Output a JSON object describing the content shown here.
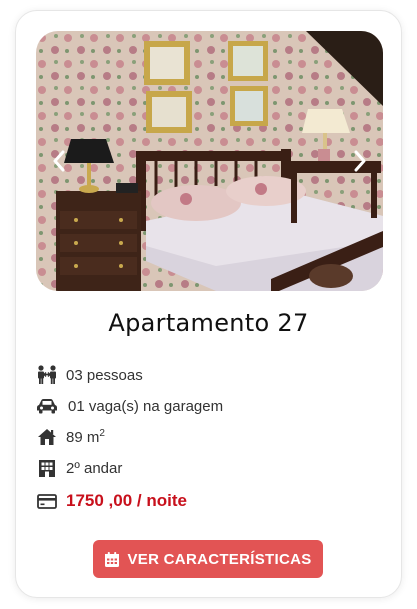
{
  "listing": {
    "title": "Apartamento 27",
    "features": {
      "guests": "03 pessoas",
      "parking": "01 vaga(s) na garagem",
      "area_value": "89 m",
      "area_unit_sup": "2",
      "floor": "2º andar",
      "price": "1750 ,00 / noite"
    },
    "button_label": "VER CARACTERÍSTICAS"
  },
  "icons": {
    "guests": "people-icon",
    "parking": "car-icon",
    "area": "house-icon",
    "floor": "building-icon",
    "price": "credit-card-icon",
    "button": "calendar-icon",
    "prev": "chevron-left-icon",
    "next": "chevron-right-icon"
  },
  "colors": {
    "price": "#c8101c",
    "button": "#e25454"
  }
}
